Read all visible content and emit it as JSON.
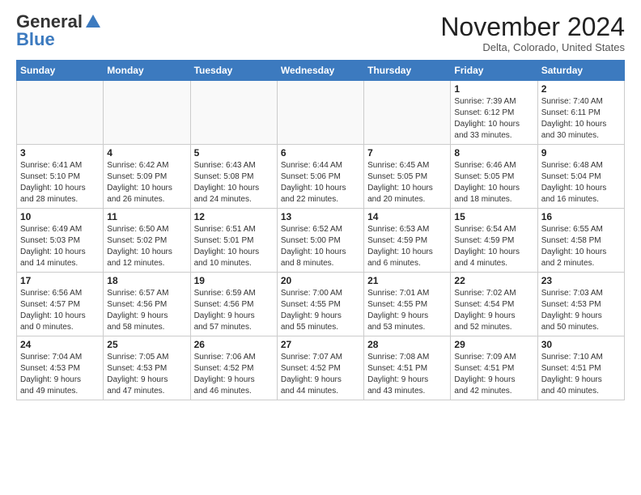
{
  "logo": {
    "general": "General",
    "blue": "Blue"
  },
  "header": {
    "month": "November 2024",
    "location": "Delta, Colorado, United States"
  },
  "weekdays": [
    "Sunday",
    "Monday",
    "Tuesday",
    "Wednesday",
    "Thursday",
    "Friday",
    "Saturday"
  ],
  "weeks": [
    [
      {
        "day": "",
        "info": ""
      },
      {
        "day": "",
        "info": ""
      },
      {
        "day": "",
        "info": ""
      },
      {
        "day": "",
        "info": ""
      },
      {
        "day": "",
        "info": ""
      },
      {
        "day": "1",
        "info": "Sunrise: 7:39 AM\nSunset: 6:12 PM\nDaylight: 10 hours\nand 33 minutes."
      },
      {
        "day": "2",
        "info": "Sunrise: 7:40 AM\nSunset: 6:11 PM\nDaylight: 10 hours\nand 30 minutes."
      }
    ],
    [
      {
        "day": "3",
        "info": "Sunrise: 6:41 AM\nSunset: 5:10 PM\nDaylight: 10 hours\nand 28 minutes."
      },
      {
        "day": "4",
        "info": "Sunrise: 6:42 AM\nSunset: 5:09 PM\nDaylight: 10 hours\nand 26 minutes."
      },
      {
        "day": "5",
        "info": "Sunrise: 6:43 AM\nSunset: 5:08 PM\nDaylight: 10 hours\nand 24 minutes."
      },
      {
        "day": "6",
        "info": "Sunrise: 6:44 AM\nSunset: 5:06 PM\nDaylight: 10 hours\nand 22 minutes."
      },
      {
        "day": "7",
        "info": "Sunrise: 6:45 AM\nSunset: 5:05 PM\nDaylight: 10 hours\nand 20 minutes."
      },
      {
        "day": "8",
        "info": "Sunrise: 6:46 AM\nSunset: 5:05 PM\nDaylight: 10 hours\nand 18 minutes."
      },
      {
        "day": "9",
        "info": "Sunrise: 6:48 AM\nSunset: 5:04 PM\nDaylight: 10 hours\nand 16 minutes."
      }
    ],
    [
      {
        "day": "10",
        "info": "Sunrise: 6:49 AM\nSunset: 5:03 PM\nDaylight: 10 hours\nand 14 minutes."
      },
      {
        "day": "11",
        "info": "Sunrise: 6:50 AM\nSunset: 5:02 PM\nDaylight: 10 hours\nand 12 minutes."
      },
      {
        "day": "12",
        "info": "Sunrise: 6:51 AM\nSunset: 5:01 PM\nDaylight: 10 hours\nand 10 minutes."
      },
      {
        "day": "13",
        "info": "Sunrise: 6:52 AM\nSunset: 5:00 PM\nDaylight: 10 hours\nand 8 minutes."
      },
      {
        "day": "14",
        "info": "Sunrise: 6:53 AM\nSunset: 4:59 PM\nDaylight: 10 hours\nand 6 minutes."
      },
      {
        "day": "15",
        "info": "Sunrise: 6:54 AM\nSunset: 4:59 PM\nDaylight: 10 hours\nand 4 minutes."
      },
      {
        "day": "16",
        "info": "Sunrise: 6:55 AM\nSunset: 4:58 PM\nDaylight: 10 hours\nand 2 minutes."
      }
    ],
    [
      {
        "day": "17",
        "info": "Sunrise: 6:56 AM\nSunset: 4:57 PM\nDaylight: 10 hours\nand 0 minutes."
      },
      {
        "day": "18",
        "info": "Sunrise: 6:57 AM\nSunset: 4:56 PM\nDaylight: 9 hours\nand 58 minutes."
      },
      {
        "day": "19",
        "info": "Sunrise: 6:59 AM\nSunset: 4:56 PM\nDaylight: 9 hours\nand 57 minutes."
      },
      {
        "day": "20",
        "info": "Sunrise: 7:00 AM\nSunset: 4:55 PM\nDaylight: 9 hours\nand 55 minutes."
      },
      {
        "day": "21",
        "info": "Sunrise: 7:01 AM\nSunset: 4:55 PM\nDaylight: 9 hours\nand 53 minutes."
      },
      {
        "day": "22",
        "info": "Sunrise: 7:02 AM\nSunset: 4:54 PM\nDaylight: 9 hours\nand 52 minutes."
      },
      {
        "day": "23",
        "info": "Sunrise: 7:03 AM\nSunset: 4:53 PM\nDaylight: 9 hours\nand 50 minutes."
      }
    ],
    [
      {
        "day": "24",
        "info": "Sunrise: 7:04 AM\nSunset: 4:53 PM\nDaylight: 9 hours\nand 49 minutes."
      },
      {
        "day": "25",
        "info": "Sunrise: 7:05 AM\nSunset: 4:53 PM\nDaylight: 9 hours\nand 47 minutes."
      },
      {
        "day": "26",
        "info": "Sunrise: 7:06 AM\nSunset: 4:52 PM\nDaylight: 9 hours\nand 46 minutes."
      },
      {
        "day": "27",
        "info": "Sunrise: 7:07 AM\nSunset: 4:52 PM\nDaylight: 9 hours\nand 44 minutes."
      },
      {
        "day": "28",
        "info": "Sunrise: 7:08 AM\nSunset: 4:51 PM\nDaylight: 9 hours\nand 43 minutes."
      },
      {
        "day": "29",
        "info": "Sunrise: 7:09 AM\nSunset: 4:51 PM\nDaylight: 9 hours\nand 42 minutes."
      },
      {
        "day": "30",
        "info": "Sunrise: 7:10 AM\nSunset: 4:51 PM\nDaylight: 9 hours\nand 40 minutes."
      }
    ]
  ]
}
